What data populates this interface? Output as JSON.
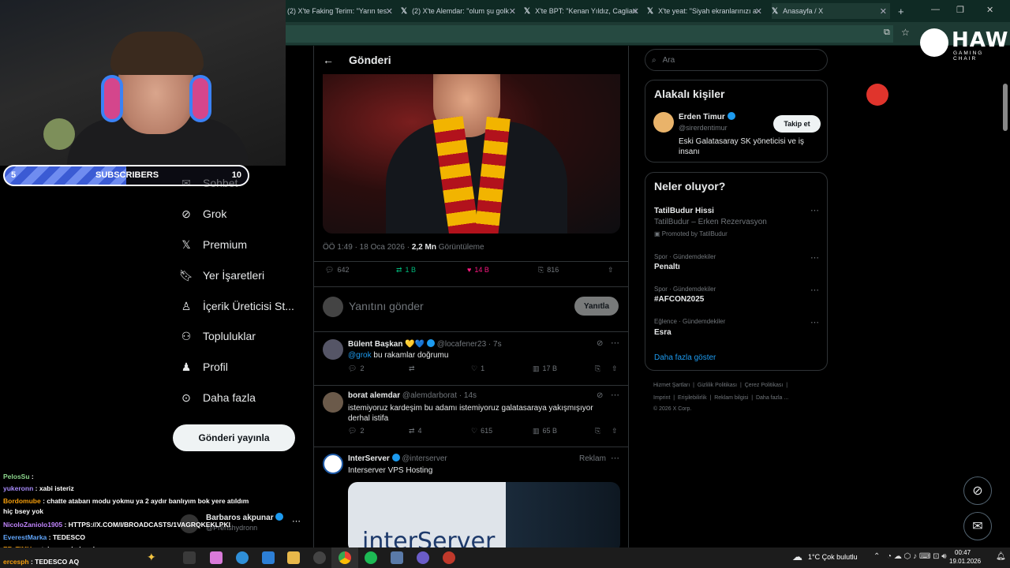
{
  "browser": {
    "tabs": [
      {
        "title": "(2) X'te Faking Terim: \"Yarın tes"
      },
      {
        "title": "(2) X'te Alemdar: \"olum şu golk"
      },
      {
        "title": "X'te BPT: \"Kenan Yıldız, Cagliari"
      },
      {
        "title": "X'te yeat: \"Siyah ekranlarınızı a"
      },
      {
        "title": "Anasayfa / X"
      }
    ],
    "new_tab": "+"
  },
  "overlay": {
    "sub_goal": {
      "current": "5",
      "label": "SUBSCRIBERS",
      "target": "10",
      "progress": 0.5
    },
    "brand_main": "HAWK",
    "brand_sub": "GAMING CHAIR"
  },
  "nav": {
    "items": [
      {
        "label": "Sohbet"
      },
      {
        "label": "Grok"
      },
      {
        "label": "Premium"
      },
      {
        "label": "Yer İşaretleri"
      },
      {
        "label": "İçerik Üreticisi St..."
      },
      {
        "label": "Topluluklar"
      },
      {
        "label": "Profil"
      },
      {
        "label": "Daha fazla"
      }
    ],
    "post_button": "Gönderi yayınla",
    "account_name": "Barbaros akpunar",
    "account_handle": "@Prenshydronn"
  },
  "chat": [
    {
      "user": "PelosSu",
      "text": ":"
    },
    {
      "user": "yukeronn",
      "text": ": xabi isteriz"
    },
    {
      "user": "Bordomube",
      "text": ": chatte atabarı modu yokmu ya 2 aydır banlıyım bok yere atıldım"
    },
    {
      "user": "",
      "text": "hiç bsey yok"
    },
    {
      "user": "NicoloZaniolo1905",
      "text": ": HTTPS://X.COM/I/BROADCASTS/1VAGRQKEKLPKI"
    },
    {
      "user": "EverestMarka",
      "text": ": TEDESCO"
    },
    {
      "user": "EF_TiMH",
      "text": ": atabarı ne halemde"
    },
    {
      "user": "ercesph",
      "text": ": TEDESCO AQ"
    }
  ],
  "main": {
    "header_title": "Gönderi",
    "post_meta": {
      "time": "ÖÖ 1:49 · 18 Oca 2026 · ",
      "views": "2,2 Mn",
      "views_label": " Görüntüleme"
    },
    "actions": {
      "replies": "642",
      "reposts": "1 B",
      "likes": "14 B",
      "bookmarks": "816"
    },
    "reply_placeholder": "Yanıtını gönder",
    "reply_button": "Yanıtla",
    "replies": [
      {
        "name": "Bülent Başkan 💛💙",
        "handle": "@locafener23 · 7s",
        "mention": "@grok",
        "text": " bu rakamlar doğrumu",
        "r": "2",
        "rt": "",
        "l": "1",
        "v": "17 B"
      },
      {
        "name": "borat alemdar",
        "handle": "@alemdarborat · 14s",
        "text": "istemiyoruz kardeşim bu adamı istemiyoruz galatasaraya yakışmışıyor derhal istifa",
        "r": "2",
        "rt": "4",
        "l": "615",
        "v": "65 B"
      }
    ],
    "ad": {
      "name": "InterServer",
      "handle": "@interserver",
      "tag": "Reklam",
      "text": "Interserver VPS Hosting",
      "brand_text": "interServer"
    }
  },
  "sidebar": {
    "search_placeholder": "Ara",
    "related_title": "Alakalı kişiler",
    "related_person": {
      "name": "Erden Timur",
      "handle": "@sirerdentimur",
      "bio": "Eski Galatasaray SK yöneticisi ve iş insanı",
      "follow": "Takip et"
    },
    "trends_title": "Neler oluyor?",
    "trends": [
      {
        "cat": "",
        "name": "TatilBudur Hissi",
        "desc": "TatilBudur – Erken Rezervasyon",
        "promo": "Promoted by TatilBudur"
      },
      {
        "cat": "Spor · Gündemdekiler",
        "name": "Penaltı"
      },
      {
        "cat": "Spor · Gündemdekiler",
        "name": "#AFCON2025"
      },
      {
        "cat": "Eğlence · Gündemdekiler",
        "name": "Esra"
      }
    ],
    "show_more": "Daha fazla göster",
    "footer": [
      "Hizmet Şartları",
      "Gizlilik Politikası",
      "Çerez Politikası",
      "Imprint",
      "Erişilebilirlik",
      "Reklam bilgisi",
      "Daha fazla ...",
      "© 2026 X Corp."
    ]
  },
  "taskbar": {
    "weather": "1°C  Çok bulutlu",
    "time": "00:47",
    "date": "19.01.2026"
  }
}
